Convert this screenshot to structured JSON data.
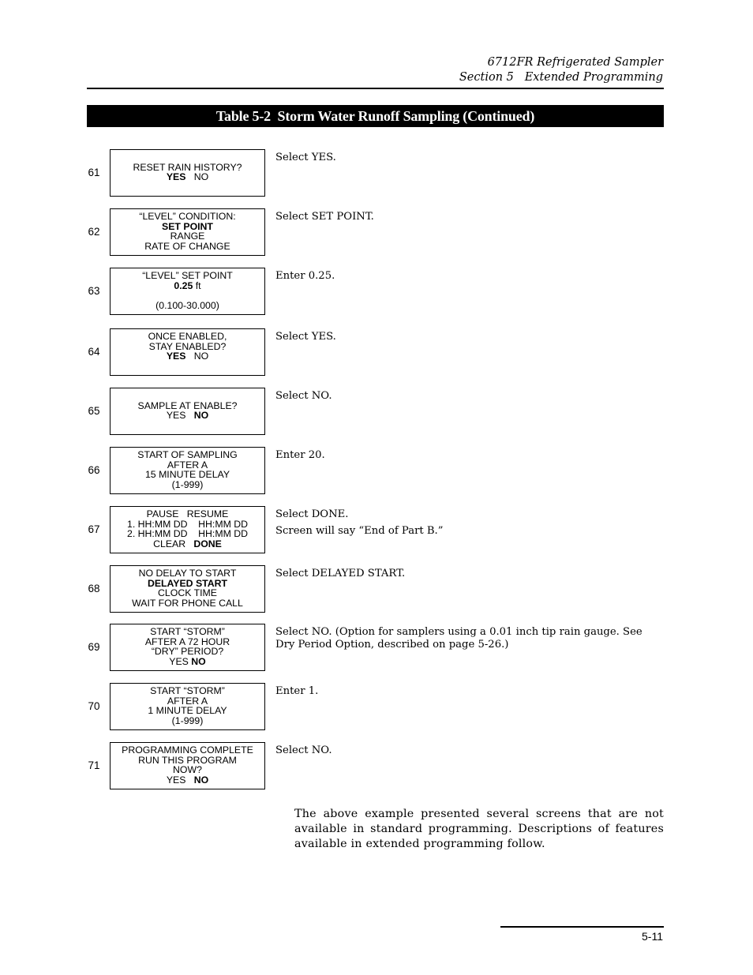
{
  "header": {
    "line1": "6712FR Refrigerated Sampler",
    "line2": "Section 5   Extended Programming"
  },
  "table": {
    "title": "Table 5-2  Storm Water Runoff Sampling (Continued)",
    "rows": [
      {
        "step": "61",
        "screen": [
          {
            "parts": []
          },
          {
            "parts": [
              {
                "t": "RESET RAIN HISTORY?",
                "b": false
              }
            ]
          },
          {
            "parts": [
              {
                "t": "YES",
                "b": true
              },
              {
                "t": "   NO",
                "b": false
              }
            ]
          }
        ],
        "instruction": "Select YES.",
        "note": ""
      },
      {
        "step": "62",
        "screen": [
          {
            "parts": [
              {
                "t": "“LEVEL” CONDITION:",
                "b": false
              }
            ]
          },
          {
            "parts": [
              {
                "t": "SET POINT",
                "b": true
              }
            ]
          },
          {
            "parts": [
              {
                "t": "RANGE",
                "b": false
              }
            ]
          },
          {
            "parts": [
              {
                "t": "RATE OF CHANGE",
                "b": false
              }
            ]
          }
        ],
        "instruction": "Select SET POINT.",
        "note": ""
      },
      {
        "step": "63",
        "screen": [
          {
            "parts": [
              {
                "t": "“LEVEL” SET POINT",
                "b": false
              }
            ]
          },
          {
            "parts": [
              {
                "t": "0.25",
                "b": true
              },
              {
                "t": " ft",
                "b": false
              }
            ]
          },
          {
            "parts": []
          },
          {
            "parts": [
              {
                "t": "(0.100-30.000)",
                "b": false
              }
            ]
          }
        ],
        "instruction": "Enter 0.25.",
        "note": ""
      },
      {
        "step": "64",
        "screen": [
          {
            "parts": [
              {
                "t": "ONCE ENABLED,",
                "b": false
              }
            ]
          },
          {
            "parts": [
              {
                "t": "STAY ENABLED?",
                "b": false
              }
            ]
          },
          {
            "parts": [
              {
                "t": "YES",
                "b": true
              },
              {
                "t": "   NO",
                "b": false
              }
            ]
          }
        ],
        "instruction": "Select YES.",
        "note": ""
      },
      {
        "step": "65",
        "screen": [
          {
            "parts": []
          },
          {
            "parts": [
              {
                "t": "SAMPLE AT ENABLE?",
                "b": false
              }
            ]
          },
          {
            "parts": [
              {
                "t": "YES   ",
                "b": false
              },
              {
                "t": "NO",
                "b": true
              }
            ]
          }
        ],
        "instruction": "Select NO.",
        "note": ""
      },
      {
        "step": "66",
        "screen": [
          {
            "parts": [
              {
                "t": "START OF SAMPLING",
                "b": false
              }
            ]
          },
          {
            "parts": [
              {
                "t": "AFTER A",
                "b": false
              }
            ]
          },
          {
            "parts": [
              {
                "t": "15 MINUTE DELAY",
                "b": false
              }
            ]
          },
          {
            "parts": [
              {
                "t": "(1-999)",
                "b": false
              }
            ]
          }
        ],
        "instruction": "Enter 20.",
        "note": ""
      },
      {
        "step": "67",
        "screen": [
          {
            "parts": [
              {
                "t": "PAUSE   RESUME",
                "b": false
              }
            ]
          },
          {
            "parts": [
              {
                "t": "1. HH:MM DD    HH:MM DD",
                "b": false
              }
            ]
          },
          {
            "parts": [
              {
                "t": "2. HH:MM DD    HH:MM DD",
                "b": false
              }
            ]
          },
          {
            "parts": [
              {
                "t": "CLEAR   ",
                "b": false
              },
              {
                "t": "DONE",
                "b": true
              }
            ]
          }
        ],
        "instruction": "Select DONE.",
        "note": "Screen will say “End of Part B.”"
      },
      {
        "step": "68",
        "screen": [
          {
            "parts": [
              {
                "t": "NO DELAY TO START",
                "b": false
              }
            ]
          },
          {
            "parts": [
              {
                "t": "DELAYED START",
                "b": true
              }
            ]
          },
          {
            "parts": [
              {
                "t": "CLOCK TIME",
                "b": false
              }
            ]
          },
          {
            "parts": [
              {
                "t": "WAIT FOR PHONE CALL",
                "b": false
              }
            ]
          }
        ],
        "instruction": "Select DELAYED START.",
        "note": ""
      },
      {
        "step": "69",
        "screen": [
          {
            "parts": [
              {
                "t": "START “STORM”",
                "b": false
              }
            ]
          },
          {
            "parts": [
              {
                "t": "AFTER A 72 HOUR",
                "b": false
              }
            ]
          },
          {
            "parts": [
              {
                "t": "“DRY” PERIOD?",
                "b": false
              }
            ]
          },
          {
            "parts": [
              {
                "t": "YES ",
                "b": false
              },
              {
                "t": "NO",
                "b": true
              }
            ]
          }
        ],
        "instruction": "Select NO. (Option for samplers using a 0.01 inch tip rain gauge. See Dry Period Option, described on page 5-26.)",
        "note": ""
      },
      {
        "step": "70",
        "screen": [
          {
            "parts": [
              {
                "t": "START “STORM”",
                "b": false
              }
            ]
          },
          {
            "parts": [
              {
                "t": "AFTER A",
                "b": false
              }
            ]
          },
          {
            "parts": [
              {
                "t": "1 MINUTE DELAY",
                "b": false
              }
            ]
          },
          {
            "parts": [
              {
                "t": "(1-999)",
                "b": false
              }
            ]
          }
        ],
        "instruction": "Enter 1.",
        "note": ""
      },
      {
        "step": "71",
        "screen": [
          {
            "parts": [
              {
                "t": "PROGRAMMING COMPLETE",
                "b": false
              }
            ]
          },
          {
            "parts": [
              {
                "t": "RUN THIS PROGRAM",
                "b": false
              }
            ]
          },
          {
            "parts": [
              {
                "t": "NOW?",
                "b": false
              }
            ]
          },
          {
            "parts": [
              {
                "t": "YES   ",
                "b": false
              },
              {
                "t": "NO",
                "b": true
              }
            ]
          }
        ],
        "instruction": "Select NO.",
        "note": ""
      }
    ]
  },
  "paragraph": "The above example presented several screens that are not available in standard programming. Descriptions of features available in extended programming follow.",
  "footer": {
    "page_number": "5-11"
  }
}
